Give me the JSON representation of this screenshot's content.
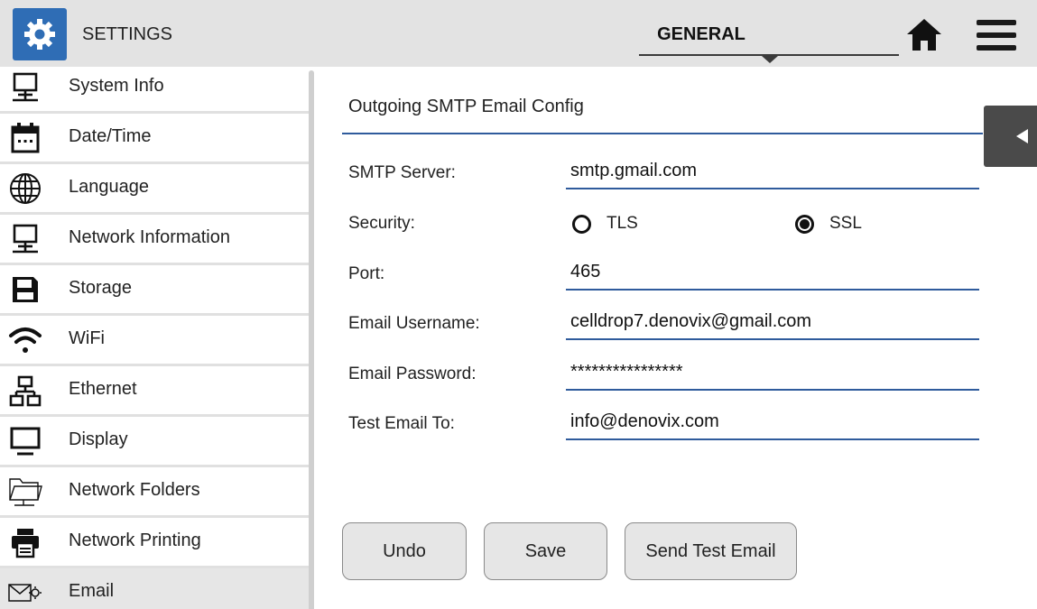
{
  "header": {
    "app_title": "SETTINGS",
    "app_icon": "gear-icon",
    "tab_label": "GENERAL",
    "home_icon": "home-icon",
    "menu_icon": "hamburger-menu-icon",
    "accent_color": "#2f6db5"
  },
  "sidebar": {
    "items": [
      {
        "label": "System Info",
        "icon": "computer-network-icon"
      },
      {
        "label": "Date/Time",
        "icon": "calendar-icon"
      },
      {
        "label": "Language",
        "icon": "globe-icon"
      },
      {
        "label": "Network Information",
        "icon": "computer-network-icon"
      },
      {
        "label": "Storage",
        "icon": "floppy-disk-icon"
      },
      {
        "label": "WiFi",
        "icon": "wifi-icon"
      },
      {
        "label": "Ethernet",
        "icon": "ethernet-icon"
      },
      {
        "label": "Display",
        "icon": "monitor-icon"
      },
      {
        "label": "Network Folders",
        "icon": "network-folder-icon"
      },
      {
        "label": "Network Printing",
        "icon": "printer-icon"
      },
      {
        "label": "Email",
        "icon": "email-settings-icon"
      }
    ],
    "active_item": "Email"
  },
  "main": {
    "section_title": "Outgoing SMTP Email Config",
    "fields": {
      "smtp_server": {
        "label": "SMTP Server:",
        "value": "smtp.gmail.com"
      },
      "security": {
        "label": "Security:",
        "options": [
          "TLS",
          "SSL"
        ],
        "selected": "SSL"
      },
      "port": {
        "label": "Port:",
        "value": "465"
      },
      "username": {
        "label": "Email Username:",
        "value": "celldrop7.denovix@gmail.com"
      },
      "password": {
        "label": "Email Password:",
        "value": "****************"
      },
      "test_to": {
        "label": "Test Email To:",
        "value": "info@denovix.com"
      }
    },
    "buttons": {
      "undo": "Undo",
      "save": "Save",
      "send_test": "Send Test Email"
    }
  }
}
